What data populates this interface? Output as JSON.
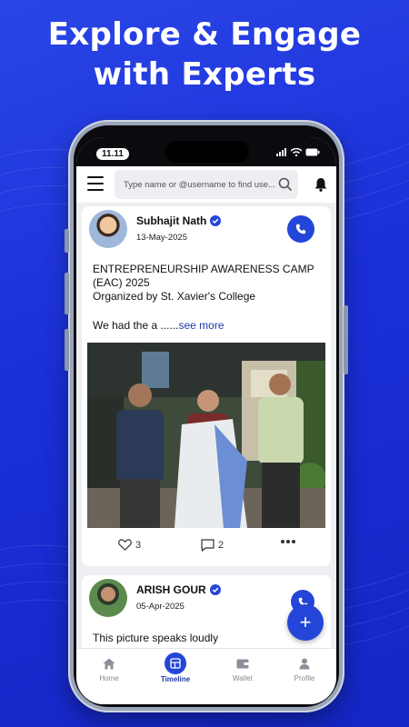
{
  "headline": {
    "line1": "Explore & Engage",
    "line2": "with Experts"
  },
  "status_bar": {
    "time": "11.11"
  },
  "topbar": {
    "search_placeholder": "Type name or @username to find use..."
  },
  "posts": [
    {
      "author": "Subhajit Nath",
      "verified": true,
      "date": "13-May-2025",
      "title_line1": "ENTREPRENEURSHIP AWARENESS CAMP",
      "title_line2": "(EAC) 2025",
      "title_line3": "Organized by St. Xavier's College",
      "body": "We had the a ......",
      "see_more": "see more",
      "likes": "3",
      "comments": "2"
    },
    {
      "author": "ARISH GOUR",
      "verified": true,
      "date": "05-Apr-2025",
      "body": "This picture speaks loudly"
    }
  ],
  "fab": {
    "add_label": "+"
  },
  "bottom_nav": [
    {
      "label": "Home",
      "icon": "home-icon"
    },
    {
      "label": "Timeline",
      "icon": "timeline-icon",
      "active": true
    },
    {
      "label": "Wallet",
      "icon": "wallet-icon"
    },
    {
      "label": "Profile",
      "icon": "profile-icon"
    }
  ],
  "colors": {
    "background": "#1f35dc",
    "accent": "#2446d8",
    "link": "#1f3aa8"
  }
}
